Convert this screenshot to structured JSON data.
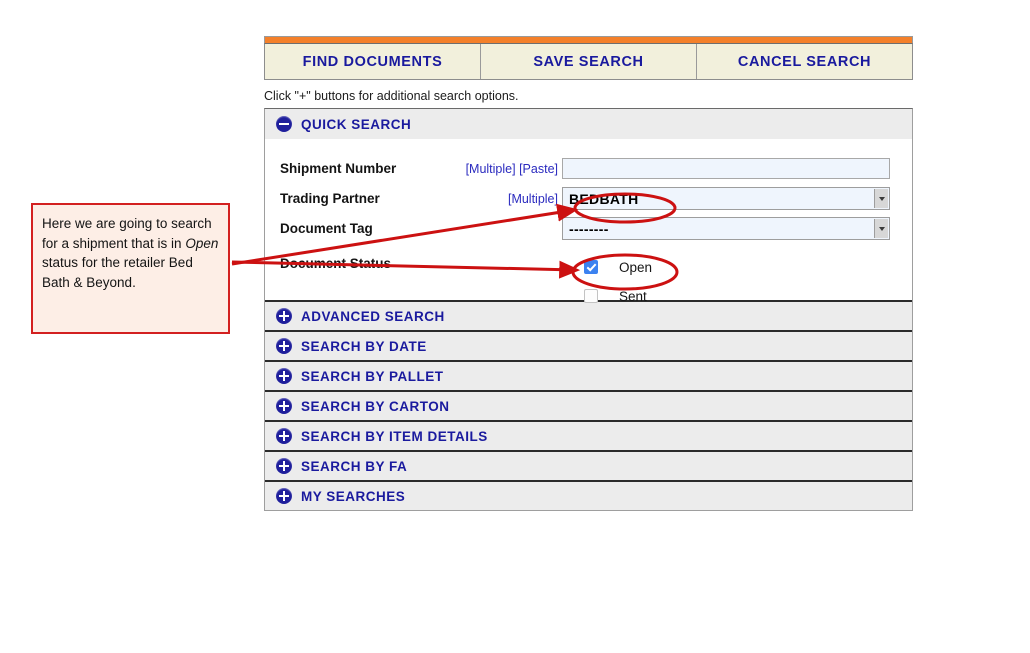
{
  "actions": {
    "buttons": [
      {
        "label": "FIND DOCUMENTS",
        "name": "find-documents-button"
      },
      {
        "label": "SAVE SEARCH",
        "name": "save-search-button"
      },
      {
        "label": "CANCEL SEARCH",
        "name": "cancel-search-button"
      }
    ]
  },
  "hint": "Click \"+\" buttons for additional search options.",
  "quick_search": {
    "title": "QUICK SEARCH",
    "expanded": true,
    "toggle_icon": "minus-circle-icon",
    "rows": [
      {
        "label": "Shipment Number",
        "links": [
          "[Multiple]",
          "[Paste]"
        ],
        "control": "text",
        "value": "",
        "placeholder": ""
      },
      {
        "label": "Trading Partner",
        "links": [
          "[Multiple]"
        ],
        "control": "select",
        "value": "BEDBATH"
      },
      {
        "label": "Document Tag",
        "links": [],
        "control": "select",
        "value": "--------"
      }
    ],
    "status": {
      "label": "Document Status",
      "options": [
        {
          "label": "Open",
          "checked": true
        },
        {
          "label": "Sent",
          "checked": false
        }
      ]
    }
  },
  "sections": [
    {
      "title": "ADVANCED SEARCH",
      "toggle_icon": "plus-circle-icon"
    },
    {
      "title": "SEARCH BY DATE",
      "toggle_icon": "plus-circle-icon"
    },
    {
      "title": "SEARCH BY PALLET",
      "toggle_icon": "plus-circle-icon"
    },
    {
      "title": "SEARCH BY CARTON",
      "toggle_icon": "plus-circle-icon"
    },
    {
      "title": "SEARCH BY ITEM DETAILS",
      "toggle_icon": "plus-circle-icon"
    },
    {
      "title": "SEARCH BY FA",
      "toggle_icon": "plus-circle-icon"
    },
    {
      "title": "MY SEARCHES",
      "toggle_icon": "plus-circle-icon"
    }
  ],
  "annotation": {
    "text_before": "Here we are going to search for a shipment that is in ",
    "emphasis": "Open",
    "text_after": " status for the retailer Bed Bath & Beyond.",
    "callout_border_color": "#d32020",
    "callout_fill_color": "#fdeee6",
    "marker_color": "#cc1111"
  },
  "colors": {
    "accent_orange": "#f4802a",
    "button_cream": "#f2f0dc",
    "navy_text": "#1a1a9e",
    "section_gray": "#ececec",
    "field_blue": "#eff5fd",
    "checkbox_blue": "#3c82f0"
  }
}
